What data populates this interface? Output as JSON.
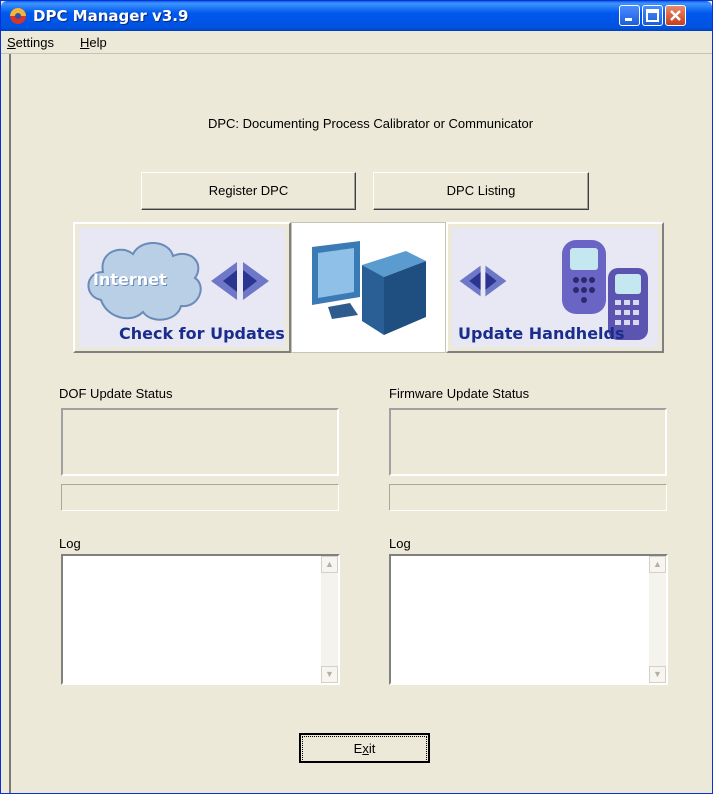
{
  "window": {
    "title": "DPC Manager v3.9"
  },
  "menu": [
    {
      "accel": "S",
      "rest": "ettings"
    },
    {
      "accel": "H",
      "rest": "elp"
    }
  ],
  "header": {
    "description": "DPC: Documenting Process Calibrator or Communicator"
  },
  "buttons": {
    "register": "Register DPC",
    "listing": "DPC Listing"
  },
  "panels": {
    "check_updates": {
      "cloud_label": "Internet",
      "caption": "Check for Updates"
    },
    "update_handhelds": {
      "caption": "Update Handhelds"
    }
  },
  "status": {
    "dof_label": "DOF Update Status",
    "firmware_label": "Firmware Update Status"
  },
  "logs": {
    "left_label": "Log",
    "right_label": "Log"
  },
  "exit": {
    "accel": "x",
    "pre": "E",
    "post": "it"
  },
  "colors": {
    "titlebar": "#0058ee",
    "face": "#ece9d8",
    "caption_blue": "#1a2d8c"
  },
  "icons": [
    "app-icon",
    "minimize-icon",
    "maximize-icon",
    "close-icon",
    "cloud-icon",
    "left-right-arrows-icon",
    "computer-icon",
    "handheld-devices-icon",
    "scroll-up-arrow-icon",
    "scroll-down-arrow-icon"
  ]
}
